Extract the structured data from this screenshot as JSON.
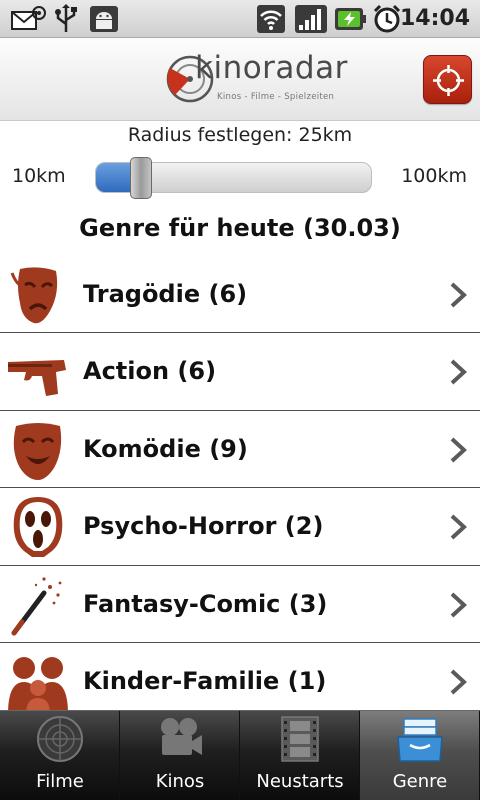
{
  "status_bar": {
    "time": "14:04",
    "icons": [
      "email-icon",
      "usb-icon",
      "android-icon",
      "wifi-icon",
      "signal-icon",
      "battery-charging-icon",
      "alarm-icon"
    ]
  },
  "header": {
    "logo_text": "kinoradar",
    "logo_subtitle": "Kinos - Filme - Spielzeiten",
    "locate_button_icon": "crosshair-icon"
  },
  "radius": {
    "title": "Radius festlegen: 25km",
    "min_label": "10km",
    "max_label": "100km",
    "value_fraction": 0.167
  },
  "genre_heading": "Genre für heute (30.03)",
  "genres": [
    {
      "label": "Tragödie (6)",
      "icon": "tragedy-mask-icon"
    },
    {
      "label": "Action (6)",
      "icon": "pistol-icon"
    },
    {
      "label": "Komödie (9)",
      "icon": "comedy-mask-icon"
    },
    {
      "label": "Psycho-Horror (2)",
      "icon": "scream-mask-icon"
    },
    {
      "label": "Fantasy-Comic (3)",
      "icon": "magic-wand-icon"
    },
    {
      "label": "Kinder-Familie (1)",
      "icon": "family-icon"
    }
  ],
  "tabs": [
    {
      "label": "Filme",
      "icon": "radar-icon",
      "active": false
    },
    {
      "label": "Kinos",
      "icon": "film-camera-icon",
      "active": false
    },
    {
      "label": "Neustarts",
      "icon": "film-strip-icon",
      "active": false
    },
    {
      "label": "Genre",
      "icon": "file-tray-icon",
      "active": true
    }
  ],
  "colors": {
    "accent_red": "#b82a14",
    "slider_blue": "#2f6bbd",
    "icon_brown": "#a03a1e"
  }
}
